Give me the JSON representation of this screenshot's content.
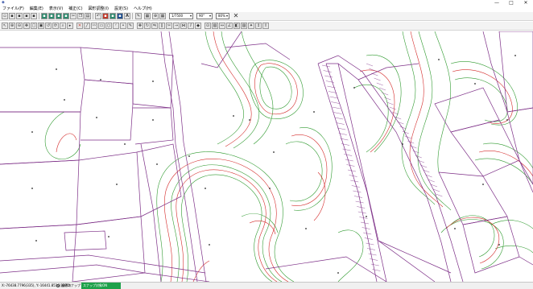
{
  "window": {
    "app_icon": "map-app-icon",
    "buttons": {
      "minimize": "—",
      "maximize": "□",
      "close": "✕"
    }
  },
  "menu": [
    "ファイル(F)",
    "編集(E)",
    "表示(V)",
    "補正(C)",
    "図形調整(I)",
    "設定(S)",
    "ヘルプ(H)"
  ],
  "toolbar": {
    "scale_value": "1/7500",
    "angle_value": "90°",
    "percent_value": "80%",
    "text_tool": "A",
    "close_symbol": "✕"
  },
  "status": {
    "coordinate_text": "X:-76438.7796(335), Y:-16441.8516(337O)",
    "snap_label": "座標スナップ",
    "snap_status": "スナップ対象ON"
  },
  "colors": {
    "parcel": "#7d2f87",
    "contour_red": "#d42a2a",
    "contour_green": "#2f9a2f",
    "status_green": "#1ea14a"
  }
}
